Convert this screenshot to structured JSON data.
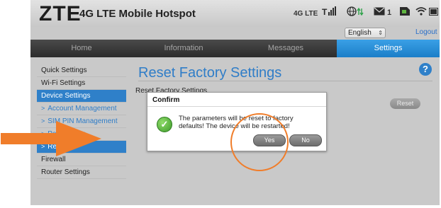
{
  "header": {
    "logo": "ZTE",
    "product": "4G LTE Mobile Hotspot",
    "network_type": "4G LTE",
    "signal_icon": "signal-bars-icon",
    "roaming_icon": "globe-data-icon",
    "messages_icon": "envelope-icon",
    "messages_count": "1",
    "sim_icon": "sim-card-icon",
    "wifi_icon": "wifi-icon",
    "battery_icon": "battery-icon"
  },
  "language": {
    "selected": "English",
    "arrow": "⇕"
  },
  "logout_label": "Logout",
  "nav": {
    "tabs": [
      {
        "label": "Home"
      },
      {
        "label": "Information"
      },
      {
        "label": "Messages"
      },
      {
        "label": "Settings",
        "active": true
      }
    ]
  },
  "sidebar": {
    "items": [
      {
        "label": "Quick Settings"
      },
      {
        "label": "Wi-Fi Settings"
      },
      {
        "label": "Device Settings",
        "active": true
      },
      {
        "label": "Account Management",
        "sub": true
      },
      {
        "label": "SIM PIN Management",
        "sub": true
      },
      {
        "label": "Power Save",
        "sub": true
      },
      {
        "label": "Reset",
        "sub": true,
        "active": true
      },
      {
        "label": "Firewall"
      },
      {
        "label": "Router Settings"
      }
    ]
  },
  "main": {
    "title": "Reset Factory Settings",
    "section_label": "Reset Factory Settings",
    "reset_button": "Reset",
    "help": "?"
  },
  "dialog": {
    "title": "Confirm",
    "message": "The parameters will be reset to factory defaults! The device will be restarted!",
    "yes_label": "Yes",
    "no_label": "No"
  },
  "colors": {
    "accent_blue": "#2f80c9",
    "annotation_orange": "#f07d2a",
    "success_green": "#3e9a2a"
  }
}
